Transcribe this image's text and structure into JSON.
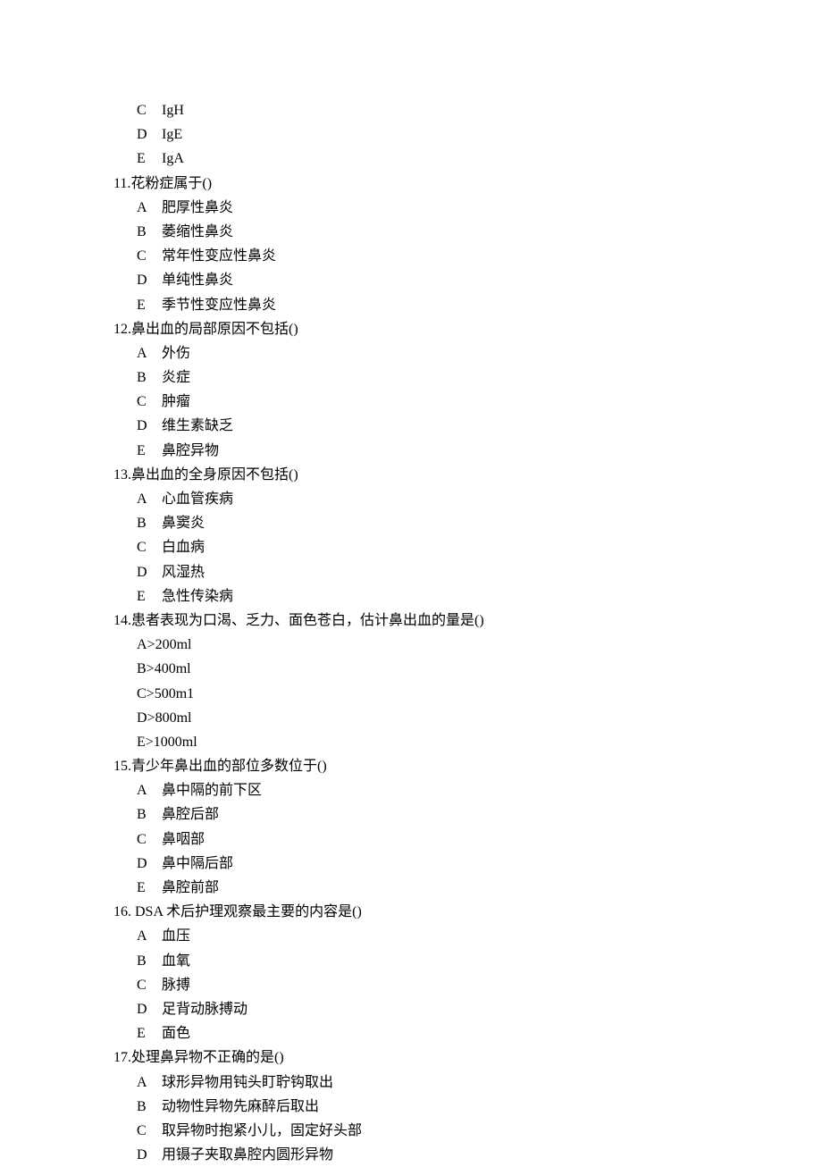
{
  "pre_options": [
    {
      "letter": "C",
      "text": "IgH"
    },
    {
      "letter": "D",
      "text": "IgE"
    },
    {
      "letter": "E",
      "text": "IgA"
    }
  ],
  "questions": [
    {
      "number": "11.",
      "stem": "花粉症属于()",
      "options": [
        {
          "letter": "A",
          "text": "肥厚性鼻炎"
        },
        {
          "letter": "B",
          "text": "萎缩性鼻炎"
        },
        {
          "letter": "C",
          "text": "常年性变应性鼻炎"
        },
        {
          "letter": "D",
          "text": "单纯性鼻炎"
        },
        {
          "letter": "E",
          "text": "季节性变应性鼻炎"
        }
      ],
      "option_style": "spaced"
    },
    {
      "number": "12.",
      "stem": "鼻出血的局部原因不包括()",
      "options": [
        {
          "letter": "A",
          "text": "外伤"
        },
        {
          "letter": "B",
          "text": "炎症"
        },
        {
          "letter": "C",
          "text": "肿瘤"
        },
        {
          "letter": "D",
          "text": "维生素缺乏"
        },
        {
          "letter": "E",
          "text": "鼻腔异物"
        }
      ],
      "option_style": "spaced"
    },
    {
      "number": "13.",
      "stem": "鼻出血的全身原因不包括()",
      "options": [
        {
          "letter": "A",
          "text": "心血管疾病"
        },
        {
          "letter": "B",
          "text": "鼻窦炎"
        },
        {
          "letter": "C",
          "text": "白血病"
        },
        {
          "letter": "D",
          "text": "风湿热"
        },
        {
          "letter": "E",
          "text": "急性传染病"
        }
      ],
      "option_style": "spaced"
    },
    {
      "number": "14.",
      "stem": "患者表现为口渴、乏力、面色苍白，估计鼻出血的量是()",
      "options": [
        {
          "letter": "A",
          "text": ">200ml"
        },
        {
          "letter": "B",
          "text": ">400ml"
        },
        {
          "letter": "C",
          "text": ">500m1"
        },
        {
          "letter": "D",
          "text": ">800ml"
        },
        {
          "letter": "E",
          "text": ">1000ml"
        }
      ],
      "option_style": "tight"
    },
    {
      "number": "15.",
      "stem": "青少年鼻出血的部位多数位于()",
      "options": [
        {
          "letter": "A",
          "text": "鼻中隔的前下区"
        },
        {
          "letter": "B",
          "text": "鼻腔后部"
        },
        {
          "letter": "C",
          "text": "鼻咽部"
        },
        {
          "letter": "D",
          "text": "鼻中隔后部"
        },
        {
          "letter": "E",
          "text": "鼻腔前部"
        }
      ],
      "option_style": "spaced"
    },
    {
      "number": "16.",
      "stem": " DSA 术后护理观察最主要的内容是()",
      "options": [
        {
          "letter": "A",
          "text": "血压"
        },
        {
          "letter": "B",
          "text": "血氧"
        },
        {
          "letter": "C",
          "text": "脉搏"
        },
        {
          "letter": "D",
          "text": "足背动脉搏动"
        },
        {
          "letter": "E",
          "text": "面色"
        }
      ],
      "option_style": "spaced"
    },
    {
      "number": "17.",
      "stem": "处理鼻异物不正确的是()",
      "options": [
        {
          "letter": "A",
          "text": "球形异物用钝头盯聍钩取出"
        },
        {
          "letter": "B",
          "text": "动物性异物先麻醉后取出"
        },
        {
          "letter": "C",
          "text": "取异物时抱紧小儿，固定好头部"
        },
        {
          "letter": "D",
          "text": "用镊子夹取鼻腔内圆形异物"
        }
      ],
      "option_style": "spaced"
    }
  ]
}
